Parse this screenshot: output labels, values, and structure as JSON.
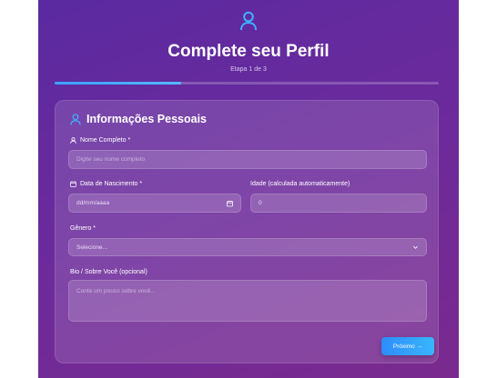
{
  "header": {
    "title": "Complete seu Perfil",
    "step": "Etapa 1 de 3",
    "icon": "user-icon"
  },
  "progress": {
    "value": 0.33,
    "color": "#3aa0ff"
  },
  "section": {
    "title": "Informações Pessoais",
    "icon": "user-icon"
  },
  "fields": {
    "full_name": {
      "label": "Nome Completo *",
      "placeholder": "Digite seu nome completo"
    },
    "birth_date": {
      "label": "Data de Nascimento *",
      "value": "dd/mm/aaaa"
    },
    "age": {
      "label": "Idade (calculada automaticamente)",
      "value": "0"
    },
    "gender": {
      "label": "Gênero *",
      "value": "Selecione..."
    },
    "bio": {
      "label": "Bio / Sobre Você (opcional)",
      "placeholder": "Conte um pouco sobre você..."
    }
  },
  "actions": {
    "next_label": "Próximo →"
  },
  "colors": {
    "background_start": "#5b2aa0",
    "background_end": "#7a2a8e",
    "accent": "#2f8cff"
  }
}
